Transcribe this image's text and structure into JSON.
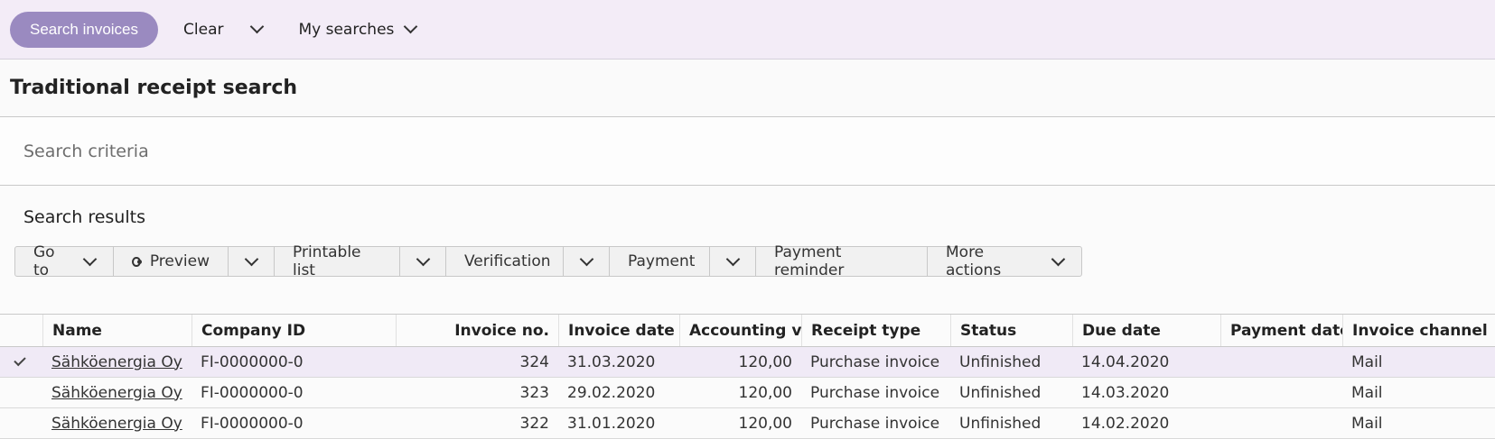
{
  "topbar": {
    "search_button": "Search invoices",
    "clear": "Clear",
    "my_searches": "My searches"
  },
  "page_title": "Traditional receipt search",
  "criteria_label": "Search criteria",
  "results_title": "Search results",
  "toolbar": {
    "goto": "Go to",
    "preview": "Preview",
    "printable_list": "Printable list",
    "verification": "Verification",
    "payment": "Payment",
    "payment_reminder": "Payment reminder",
    "more_actions": "More actions"
  },
  "table": {
    "columns": [
      "Name",
      "Company ID",
      "Invoice no.",
      "Invoice date",
      "Accounting val",
      "Receipt type",
      "Status",
      "Due date",
      "Payment date",
      "Invoice channel"
    ],
    "rows": [
      {
        "name": "Sähköenergia Oy",
        "company_id": "FI-0000000-0",
        "invoice_no": "324",
        "invoice_date": "31.03.2020",
        "accounting_value": "120,00",
        "receipt_type": "Purchase invoice",
        "status": "Unfinished",
        "due_date": "14.04.2020",
        "payment_date": "",
        "channel": "Mail"
      },
      {
        "name": "Sähköenergia Oy",
        "company_id": "FI-0000000-0",
        "invoice_no": "323",
        "invoice_date": "29.02.2020",
        "accounting_value": "120,00",
        "receipt_type": "Purchase invoice",
        "status": "Unfinished",
        "due_date": "14.03.2020",
        "payment_date": "",
        "channel": "Mail"
      },
      {
        "name": "Sähköenergia Oy",
        "company_id": "FI-0000000-0",
        "invoice_no": "322",
        "invoice_date": "31.01.2020",
        "accounting_value": "120,00",
        "receipt_type": "Purchase invoice",
        "status": "Unfinished",
        "due_date": "14.02.2020",
        "payment_date": "",
        "channel": "Mail"
      }
    ]
  },
  "colors": {
    "accent": "#9a8ac0",
    "topbar_bg": "#f3ecf7",
    "selected_row": "#f0eaf6"
  }
}
